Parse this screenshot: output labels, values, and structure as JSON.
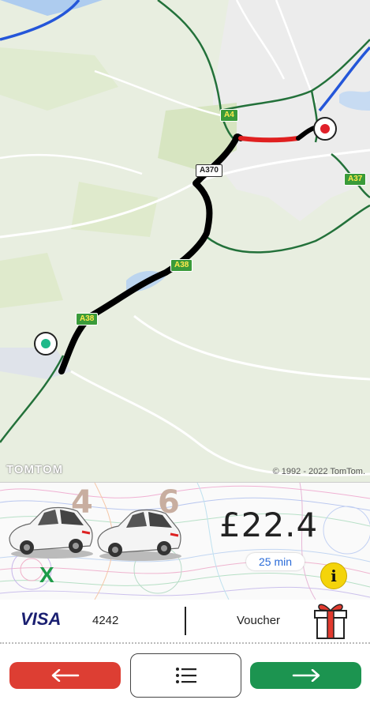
{
  "map": {
    "road_labels": {
      "a4": "A4",
      "a370": "A370",
      "a37": "A37",
      "a38_upper": "A38",
      "a38_lower": "A38"
    },
    "brand": "TOMTOM",
    "copyright": "© 1992 - 2022 TomTom.",
    "origin_pin_color": "#1fb98a",
    "destination_pin_color": "#e0202a",
    "route_color": "#000000",
    "traffic_color": "#e02020"
  },
  "ride": {
    "car_counts": [
      "4",
      "6"
    ],
    "price": "£22.4",
    "eta": "25 min",
    "cancel": "X",
    "info": "i"
  },
  "payment": {
    "card_brand": "VISA",
    "card_last4": "4242",
    "voucher": "Voucher"
  },
  "nav": {
    "back_icon": "arrow-left-icon",
    "list_icon": "list-icon",
    "next_icon": "arrow-right-icon"
  },
  "colors": {
    "back": "#dd3e33",
    "next": "#1c9450",
    "info": "#f4d40a",
    "eta_text": "#2a6bd8"
  }
}
